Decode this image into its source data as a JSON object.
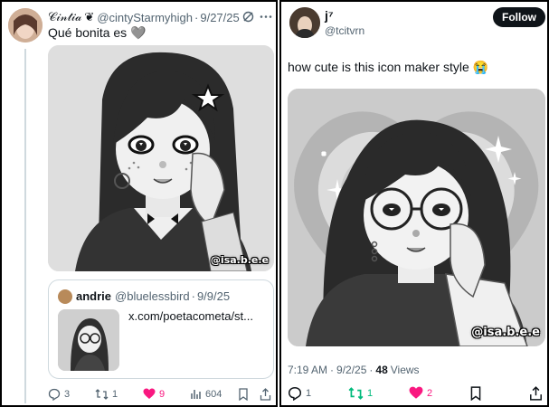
{
  "left_post": {
    "display_name": "𝒞𝒾𝓃𝓉𝒾𝒶",
    "name_emoji": "❦",
    "handle": "@cintyStarmyhigh",
    "separator": "·",
    "date": "9/27/25",
    "text": "Qué bonita es 🩶",
    "watermark": "@isa.b.e.e",
    "quote": {
      "name": "andrie",
      "handle": "@bluelessbird",
      "separator": "·",
      "date": "9/9/25",
      "link": "x.com/poetacometa/st..."
    },
    "actions": {
      "replies": "3",
      "reposts": "1",
      "likes": "9",
      "views": "604"
    }
  },
  "right_post": {
    "display_name": "j⁷",
    "handle": "@tcitvrn",
    "follow_label": "Follow",
    "text": "how cute is this icon maker style 😭",
    "watermark": "@isa.b.e.e",
    "meta": {
      "time": "7:19 AM",
      "sep1": "·",
      "date": "9/2/25",
      "sep2": "·",
      "views_count": "48",
      "views_label": "Views"
    },
    "actions": {
      "replies": "1",
      "reposts": "1",
      "likes": "2"
    }
  },
  "icons": [
    "grok-icon",
    "more-icon",
    "reply-icon",
    "repost-icon",
    "like-icon",
    "views-icon",
    "bookmark-icon",
    "share-icon"
  ],
  "colors": {
    "like_active": "#f91880",
    "repost_active": "#00ba7c",
    "muted": "#536471",
    "border": "#cfd9de",
    "follow_button": "#0f1419"
  }
}
